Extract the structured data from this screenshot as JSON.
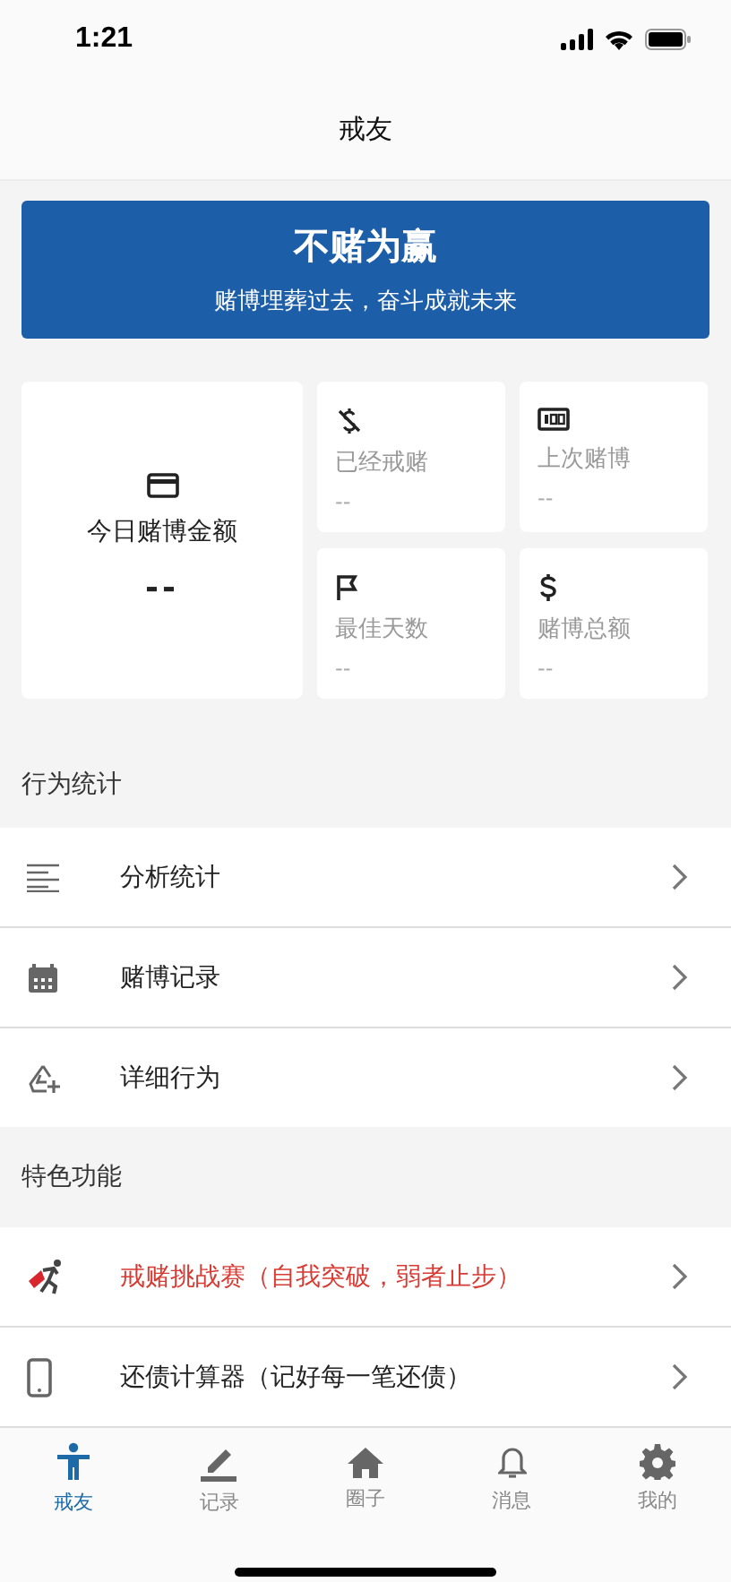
{
  "status_bar": {
    "time": "1:21"
  },
  "nav": {
    "title": "戒友"
  },
  "banner": {
    "title": "不赌为赢",
    "subtitle": "赌博埋葬过去，奋斗成就未来"
  },
  "today": {
    "label": "今日赌博金额",
    "value": "--"
  },
  "stats": [
    {
      "label": "已经戒赌",
      "value": "--"
    },
    {
      "label": "上次赌博",
      "value": "--"
    },
    {
      "label": "最佳天数",
      "value": "--"
    },
    {
      "label": "赌博总额",
      "value": "--"
    }
  ],
  "sections": [
    {
      "title": "行为统计",
      "items": [
        {
          "label": "分析统计",
          "kind": "normal"
        },
        {
          "label": "赌博记录",
          "kind": "normal"
        },
        {
          "label": "详细行为",
          "kind": "normal"
        }
      ]
    },
    {
      "title": "特色功能",
      "items": [
        {
          "label": "戒赌挑战赛（自我突破，弱者止步）",
          "kind": "promo"
        },
        {
          "label": "还债计算器（记好每一笔还债）",
          "kind": "normal"
        }
      ]
    }
  ],
  "tabs": [
    {
      "label": "戒友",
      "selected": true
    },
    {
      "label": "记录",
      "selected": false
    },
    {
      "label": "圈子",
      "selected": false
    },
    {
      "label": "消息",
      "selected": false
    },
    {
      "label": "我的",
      "selected": false
    }
  ]
}
